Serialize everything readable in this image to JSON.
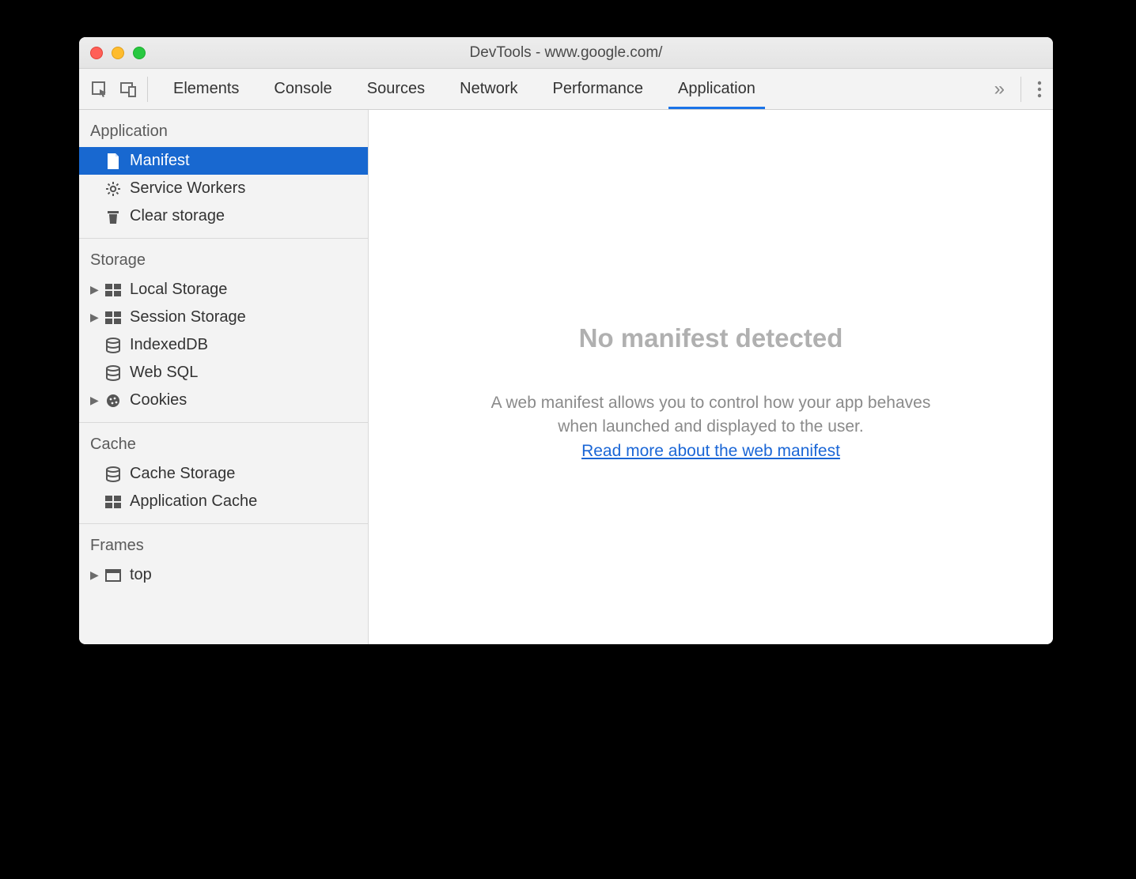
{
  "window": {
    "title": "DevTools - www.google.com/"
  },
  "tabbar": {
    "tabs": [
      {
        "label": "Elements"
      },
      {
        "label": "Console"
      },
      {
        "label": "Sources"
      },
      {
        "label": "Network"
      },
      {
        "label": "Performance"
      },
      {
        "label": "Application",
        "active": true
      }
    ],
    "overflow": "»"
  },
  "sidebar": {
    "sections": {
      "application": {
        "title": "Application",
        "items": {
          "manifest": "Manifest",
          "service_workers": "Service Workers",
          "clear_storage": "Clear storage"
        }
      },
      "storage": {
        "title": "Storage",
        "items": {
          "local_storage": "Local Storage",
          "session_storage": "Session Storage",
          "indexeddb": "IndexedDB",
          "web_sql": "Web SQL",
          "cookies": "Cookies"
        }
      },
      "cache": {
        "title": "Cache",
        "items": {
          "cache_storage": "Cache Storage",
          "application_cache": "Application Cache"
        }
      },
      "frames": {
        "title": "Frames",
        "items": {
          "top": "top"
        }
      }
    }
  },
  "main": {
    "heading": "No manifest detected",
    "description": "A web manifest allows you to control how your app behaves when launched and displayed to the user.",
    "link_text": "Read more about the web manifest"
  }
}
